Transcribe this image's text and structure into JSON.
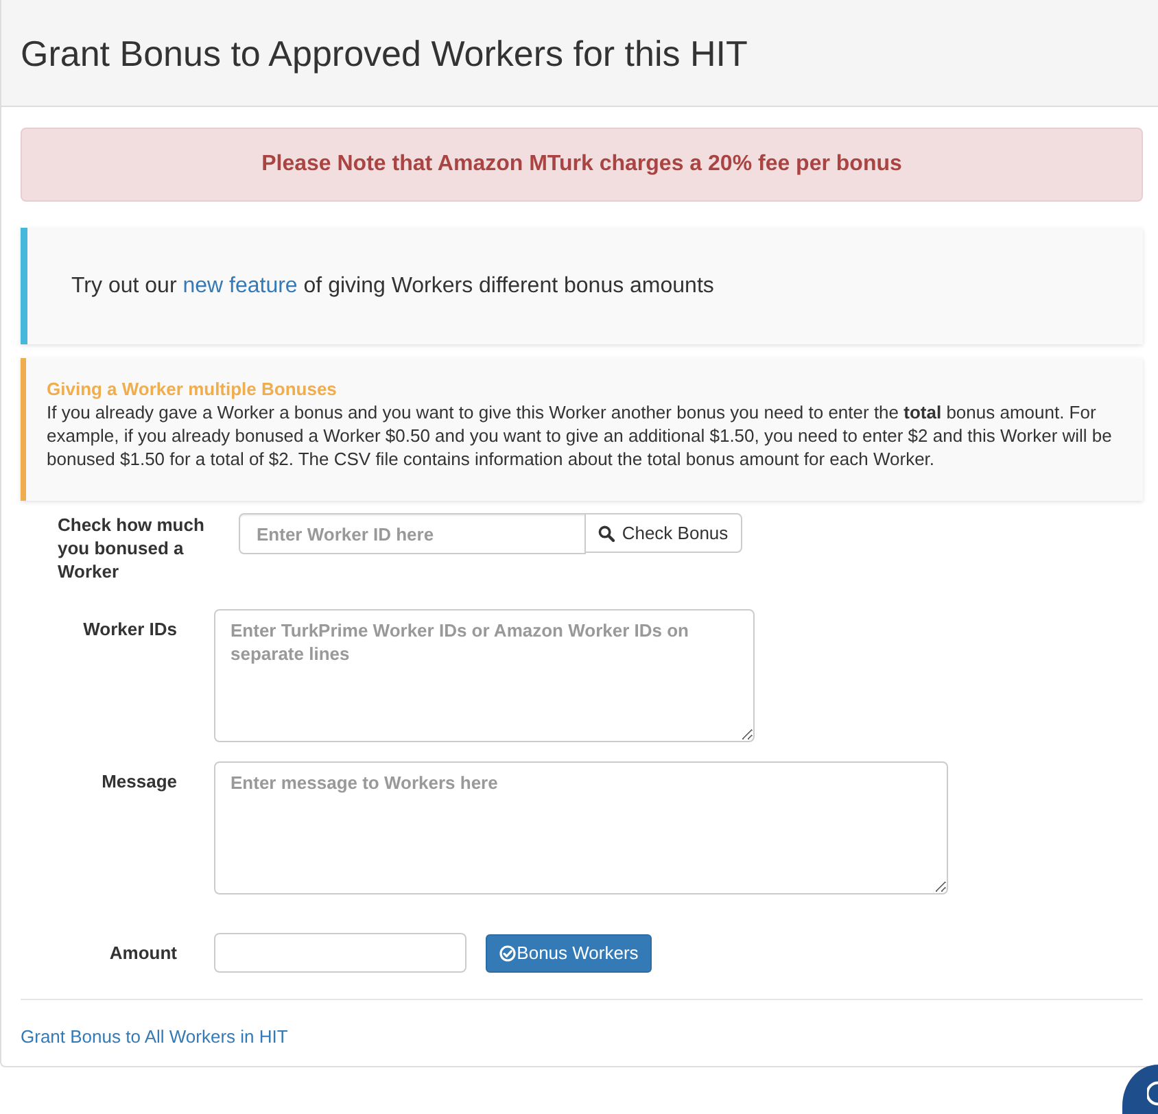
{
  "header": {
    "title": "Grant Bonus to Approved Workers for this HIT"
  },
  "fee_alert": {
    "text": "Please Note that Amazon MTurk charges a 20% fee per bonus"
  },
  "feature_callout": {
    "text_before": "Try out our",
    "link": "new feature",
    "text_after": "of giving Workers different bonus amounts"
  },
  "multiple_bonus_note": {
    "title": "Giving a Worker multiple Bonuses",
    "body": "If you already gave a Worker a bonus and you want to give this Worker another bonus you need to enter the **total** bonus amount. For example, if you already bonused a Worker $0.50 and you want to give an additional $1.50, you need to enter $2 and this Worker will be bonused $1.50 for a total of $2. The CSV file contains information about the total bonus amount for each Worker."
  },
  "check_bonus": {
    "label": "Check how much you bonused a Worker",
    "placeholder": "Enter Worker ID here",
    "button": "Check Bonus"
  },
  "worker_ids": {
    "label": "Worker IDs",
    "placeholder": "Enter TurkPrime Worker IDs or Amazon Worker IDs on separate lines"
  },
  "message": {
    "label": "Message",
    "placeholder": "Enter message to Workers here"
  },
  "amount": {
    "label": "Amount",
    "button": "Bonus Workers"
  },
  "footer_link": "Grant Bonus to All Workers in HIT"
}
